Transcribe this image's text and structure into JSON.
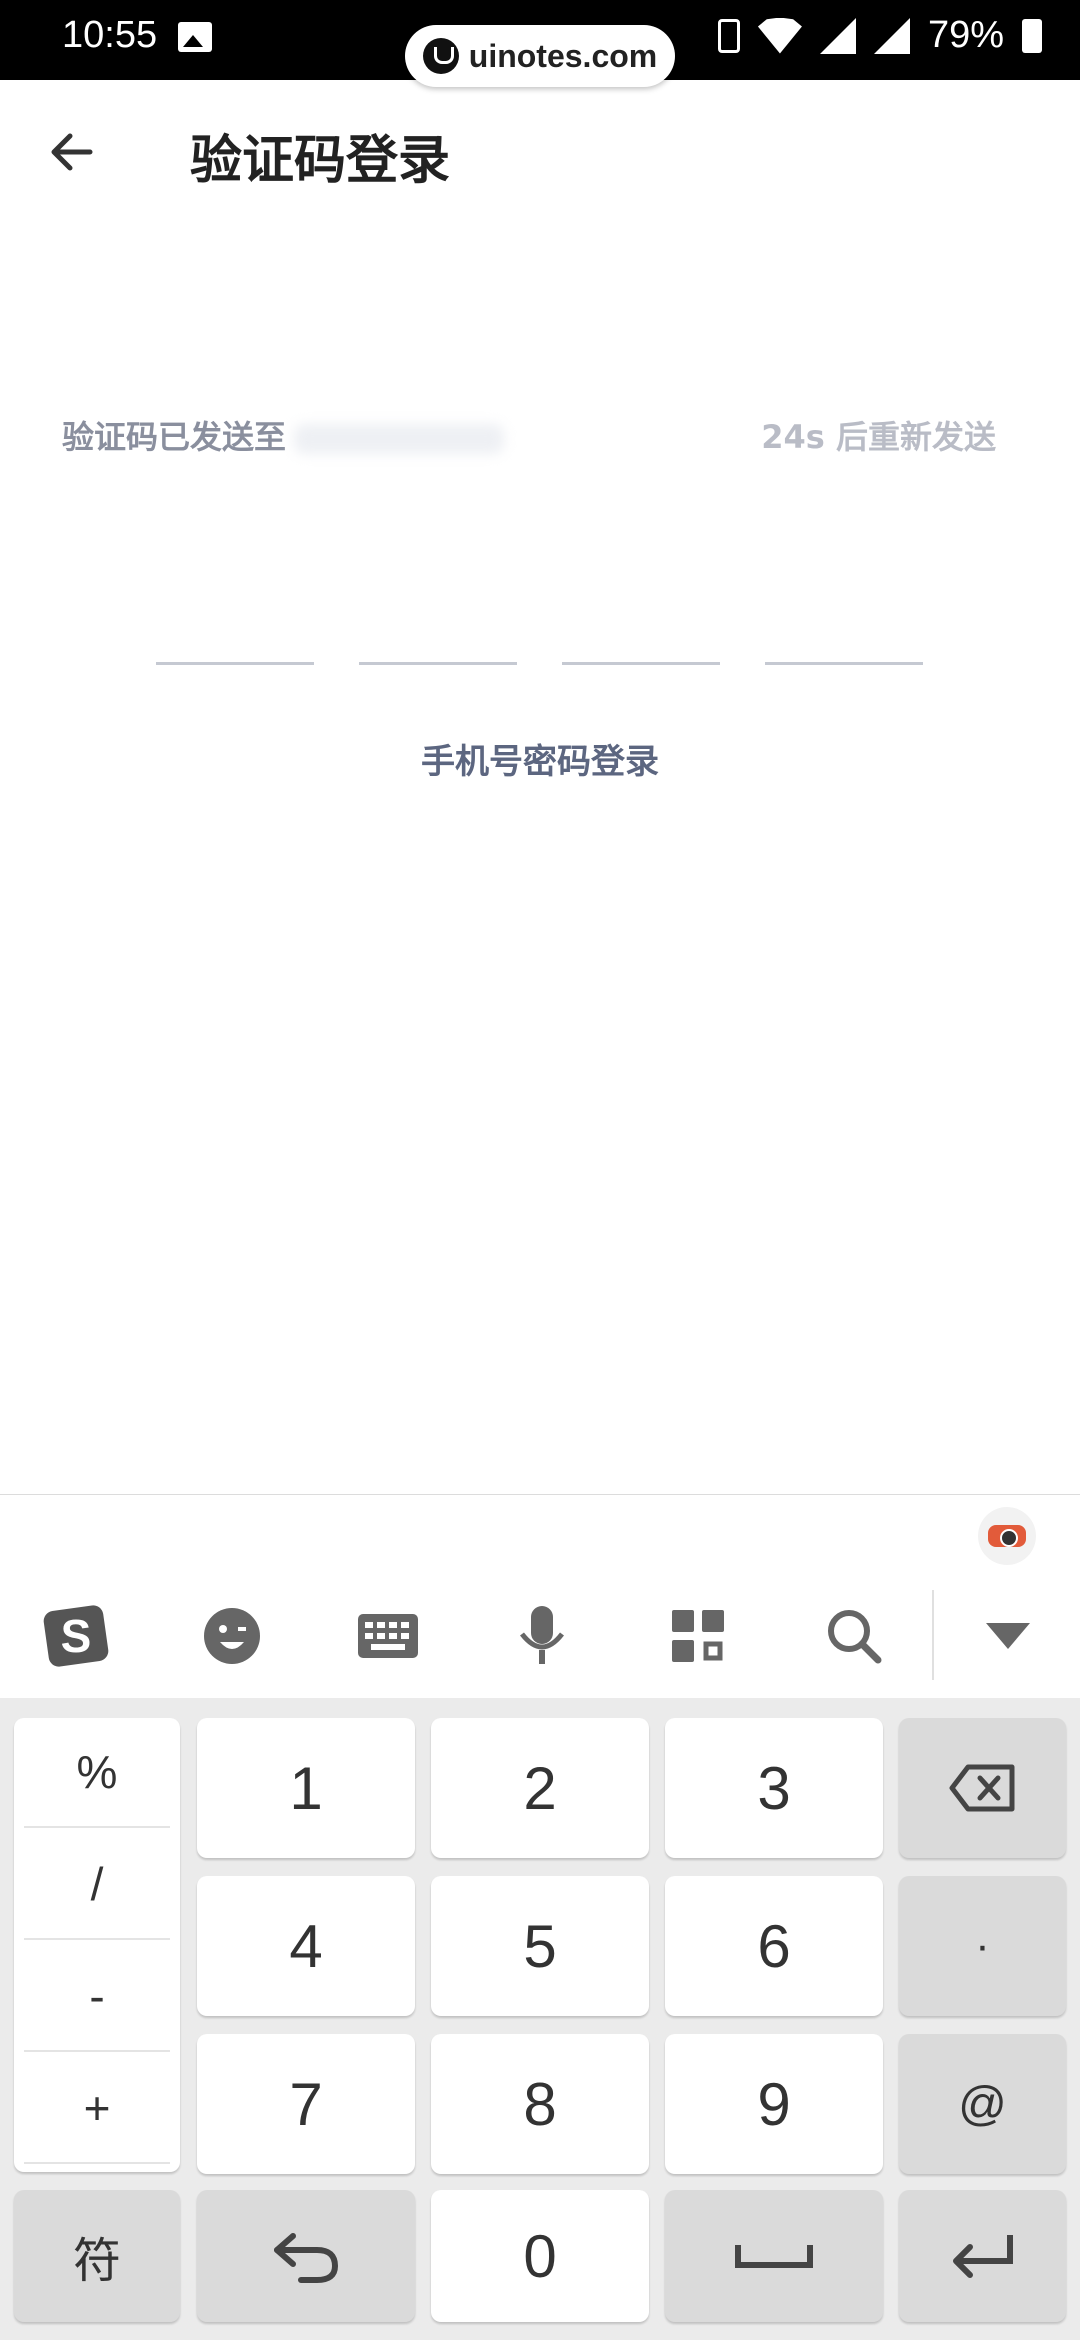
{
  "status_bar": {
    "time": "10:55",
    "battery": "79%",
    "watermark": "uinotes.com"
  },
  "header": {
    "title": "验证码登录"
  },
  "verify": {
    "sent_label": "验证码已发送至",
    "resend_label": "24s 后重新发送"
  },
  "alt_login": {
    "label": "手机号密码登录"
  },
  "keyboard": {
    "toolbar": [
      "sogou-logo-icon",
      "emoji-icon",
      "keyboard-icon",
      "microphone-icon",
      "apps-grid-icon",
      "search-icon",
      "collapse-icon"
    ],
    "symbols": [
      "%",
      "/",
      "-",
      "+"
    ],
    "digits": [
      "1",
      "2",
      "3",
      "4",
      "5",
      "6",
      "7",
      "8",
      "9"
    ],
    "zero": "0",
    "dot": "·",
    "at": "@",
    "fu_label": "符"
  }
}
